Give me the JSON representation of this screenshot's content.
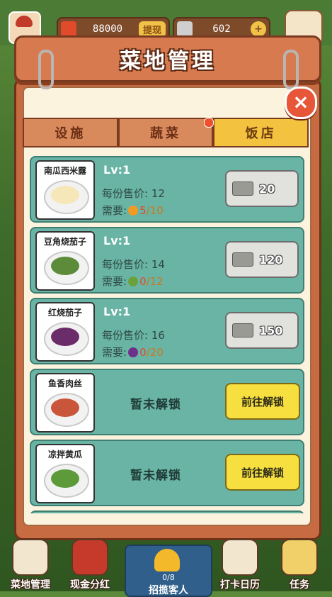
{
  "top": {
    "money": "88000",
    "withdraw_label": "提现",
    "tickets": "602",
    "plus_label": "+"
  },
  "panel": {
    "title": "菜地管理",
    "close_label": "×"
  },
  "tabs": [
    {
      "label": "设施",
      "active": false
    },
    {
      "label": "蔬菜",
      "active": false
    },
    {
      "label": "饭店",
      "active": true
    }
  ],
  "dishes": [
    {
      "name": "南瓜西米露",
      "lv": "Lv:1",
      "price_label": "每份售价:",
      "price": "12",
      "need_label": "需要:",
      "have": "5",
      "total": "/10",
      "cost": "20",
      "food_color": "#f6e7b8",
      "ing_color": "#f39a24"
    },
    {
      "name": "豆角烧茄子",
      "lv": "Lv:1",
      "price_label": "每份售价:",
      "price": "14",
      "need_label": "需要:",
      "have": "0",
      "total": "/12",
      "cost": "120",
      "food_color": "#5c8b3a",
      "ing_color": "#6aa13b"
    },
    {
      "name": "红烧茄子",
      "lv": "Lv:1",
      "price_label": "每份售价:",
      "price": "16",
      "need_label": "需要:",
      "have": "0",
      "total": "/20",
      "cost": "150",
      "food_color": "#6b2c6a",
      "ing_color": "#6e2f8a"
    },
    {
      "name": "鱼香肉丝",
      "locked_label": "暂未解锁",
      "go_label": "前往解锁",
      "food_color": "#c9553a"
    },
    {
      "name": "凉拌黄瓜",
      "locked_label": "暂未解锁",
      "go_label": "前往解锁",
      "food_color": "#5c9a3a"
    }
  ],
  "bell": {
    "count": "0/8",
    "label": "招揽客人"
  },
  "nav": [
    {
      "label": "菜地管理",
      "icon": "shovel-icon"
    },
    {
      "label": "现金分红",
      "icon": "cash-icon"
    },
    {
      "label": "打卡日历",
      "icon": "calendar-icon"
    },
    {
      "label": "任务",
      "icon": "task-icon"
    }
  ]
}
